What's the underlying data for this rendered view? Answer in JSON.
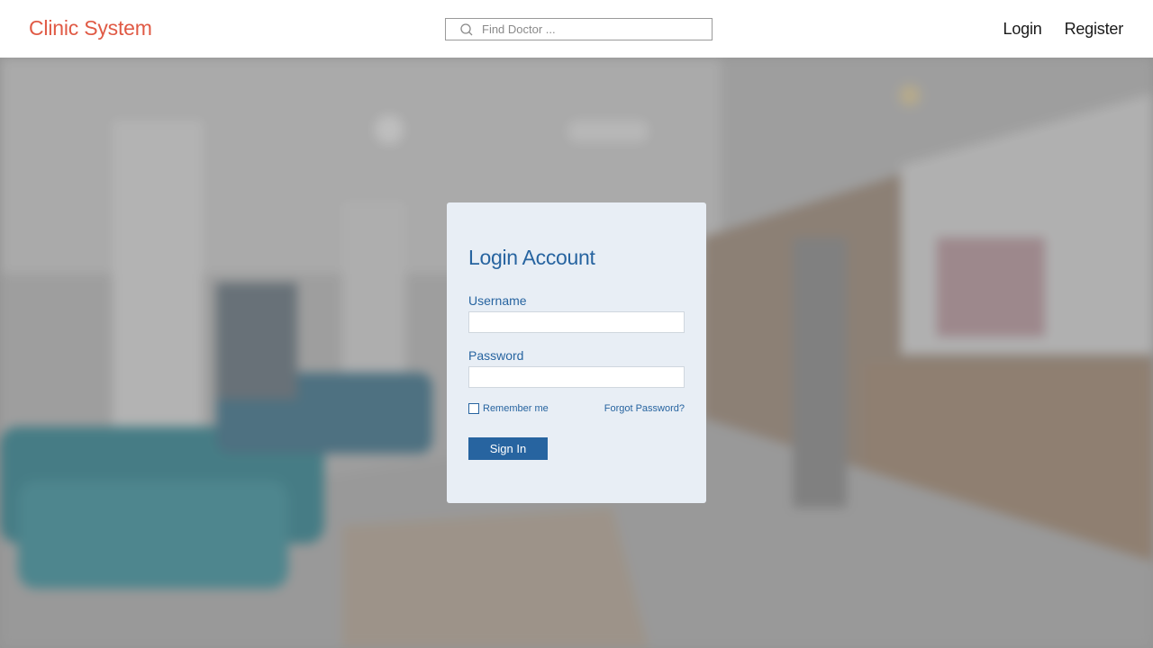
{
  "header": {
    "brand": "Clinic System",
    "search_placeholder": "Find Doctor ...",
    "search_icon": "search-icon",
    "nav": [
      {
        "label": "Login"
      },
      {
        "label": "Register"
      }
    ]
  },
  "login": {
    "title": "Login Account",
    "username_label": "Username",
    "username_value": "",
    "password_label": "Password",
    "password_value": "",
    "remember_label": "Remember me",
    "remember_checked": false,
    "forgot_label": "Forgot Password?",
    "submit_label": "Sign In"
  },
  "colors": {
    "brand": "#e05a45",
    "accent": "#2764a0",
    "card_bg": "#e8eef5"
  }
}
